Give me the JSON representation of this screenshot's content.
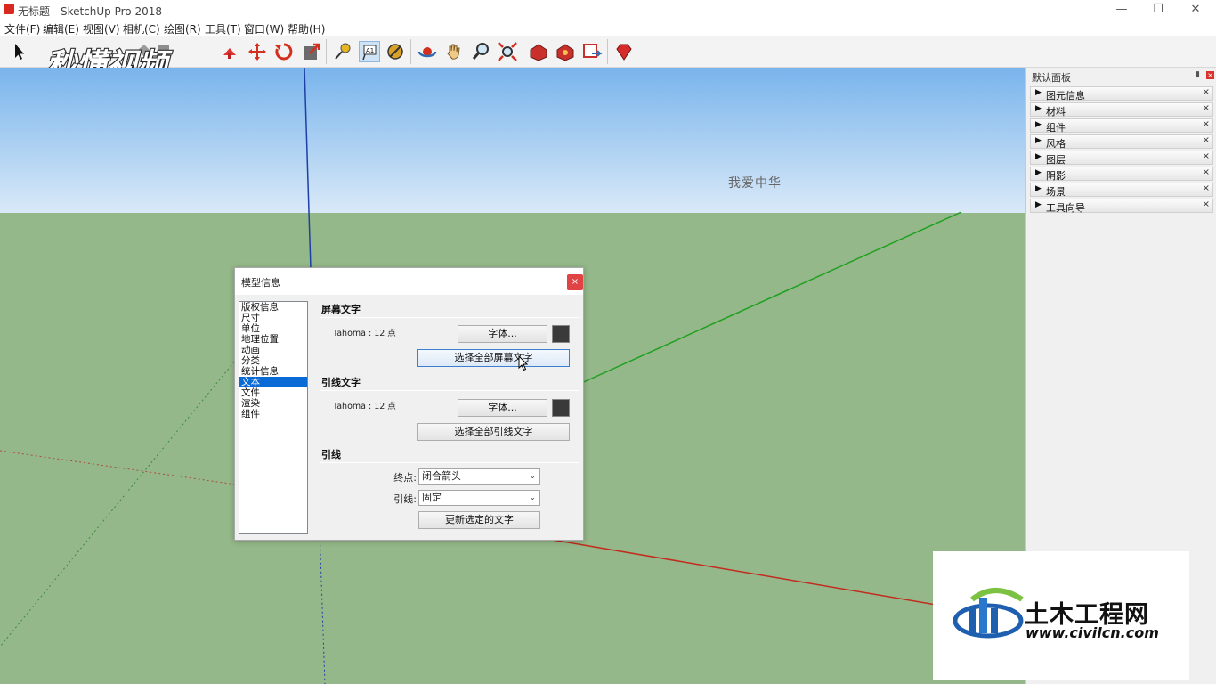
{
  "window": {
    "title": "无标题 - SketchUp Pro 2018",
    "minimize": "—",
    "restore": "❐",
    "close": "✕"
  },
  "menu": [
    "文件(F)",
    "编辑(E)",
    "视图(V)",
    "相机(C)",
    "绘图(R)",
    "工具(T)",
    "窗口(W)",
    "帮助(H)"
  ],
  "toolbar": {
    "tools": [
      "select",
      "eraser",
      "paint-bucket",
      "pencil",
      "push-pull",
      "move",
      "rotate",
      "scale",
      "tape-measure",
      "text",
      "paint",
      "orbit",
      "pan",
      "zoom",
      "zoom-extents",
      "warehouse",
      "extension-warehouse",
      "layout",
      "ruby"
    ]
  },
  "watermark_top": {
    "text": "秒懂视频"
  },
  "viewport": {
    "screen_text": "我爱中华",
    "sky_color": "#79b4ec",
    "ground_color": "#94b889"
  },
  "panel": {
    "title": "默认面板",
    "trays": [
      "图元信息",
      "材料",
      "组件",
      "风格",
      "图层",
      "阴影",
      "场景",
      "工具向导"
    ]
  },
  "dialog": {
    "title": "模型信息",
    "close": "×",
    "categories": [
      "版权信息",
      "尺寸",
      "单位",
      "地理位置",
      "动画",
      "分类",
      "统计信息",
      "文本",
      "文件",
      "渲染",
      "组件"
    ],
    "selected_category": "文本",
    "screen_text": {
      "heading": "屏幕文字",
      "font_info": "Tahoma : 12 点",
      "font_button": "字体...",
      "select_all_button": "选择全部屏幕文字",
      "color": "#3a3a3a"
    },
    "leader_text": {
      "heading": "引线文字",
      "font_info": "Tahoma : 12 点",
      "font_button": "字体...",
      "select_all_button": "选择全部引线文字",
      "color": "#3a3a3a"
    },
    "leader_lines": {
      "heading": "引线",
      "endpoint_label": "终点:",
      "endpoint_value": "闭合箭头",
      "leader_label": "引线:",
      "leader_value": "固定",
      "update_button": "更新选定的文字"
    }
  },
  "watermark_bottom": {
    "name": "土木工程网",
    "url": "www.civilcn.com"
  }
}
